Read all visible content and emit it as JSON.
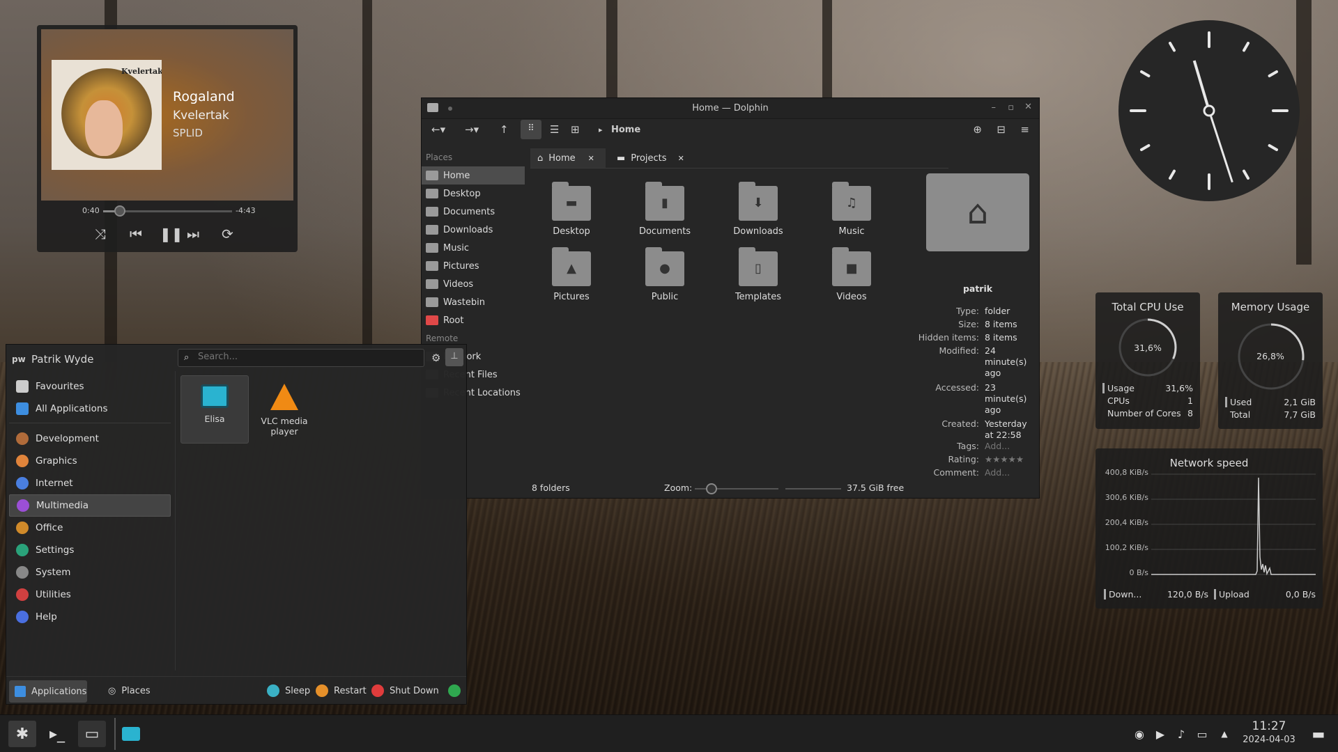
{
  "media": {
    "title": "Rogaland",
    "artist": "Kvelertak",
    "album": "SPLID",
    "band_logo": "Kvelertak",
    "elapsed": "0:40",
    "remaining": "-4:43",
    "progress": 0.13,
    "icons": [
      "shuffle-icon",
      "previous-icon",
      "pause-icon",
      "next-icon",
      "repeat-icon"
    ]
  },
  "dolphin": {
    "title": "Home — Dolphin",
    "breadcrumb": "Home",
    "places_header": "Places",
    "places": [
      "Home",
      "Desktop",
      "Documents",
      "Downloads",
      "Music",
      "Pictures",
      "Videos",
      "Wastebin",
      "Root"
    ],
    "remote_header": "Remote",
    "remote_items": [
      "Network"
    ],
    "recent_items": [
      "Recent Files",
      "Recent Locations"
    ],
    "tabs": [
      "Home",
      "Projects"
    ],
    "folders": [
      {
        "label": "Desktop",
        "glyph": "▬"
      },
      {
        "label": "Documents",
        "glyph": "▮"
      },
      {
        "label": "Downloads",
        "glyph": "⬇"
      },
      {
        "label": "Music",
        "glyph": "♫"
      },
      {
        "label": "Pictures",
        "glyph": "▲"
      },
      {
        "label": "Public",
        "glyph": "●"
      },
      {
        "label": "Templates",
        "glyph": "▯"
      },
      {
        "label": "Videos",
        "glyph": "■"
      }
    ],
    "info": {
      "name": "patrik",
      "rows": [
        [
          "Type:",
          "folder"
        ],
        [
          "Size:",
          "8 items"
        ],
        [
          "Hidden items:",
          "8 items"
        ],
        [
          "Modified:",
          "24 minute(s) ago"
        ],
        [
          "Accessed:",
          "23 minute(s) ago"
        ],
        [
          "Created:",
          "Yesterday at 22:58"
        ],
        [
          "Tags:",
          "Add..."
        ],
        [
          "Rating:",
          "★★★★★"
        ],
        [
          "Comment:",
          "Add..."
        ]
      ]
    },
    "status_left": "8 folders",
    "zoom_label": "Zoom:",
    "zoom_level": 0.1,
    "status_right": "37.5 GiB free"
  },
  "launcher": {
    "user": "Patrik Wyde",
    "search_placeholder": "Search...",
    "top": [
      {
        "label": "Favourites",
        "color": "#ccc"
      },
      {
        "label": "All Applications",
        "color": "#3d8ee0"
      }
    ],
    "categories": [
      {
        "label": "Development",
        "color": "#b06b3a"
      },
      {
        "label": "Graphics",
        "color": "#e0843b"
      },
      {
        "label": "Internet",
        "color": "#4a7fe0"
      },
      {
        "label": "Multimedia",
        "color": "#9b4fd6"
      },
      {
        "label": "Office",
        "color": "#d08a2a"
      },
      {
        "label": "Settings",
        "color": "#2aa27a"
      },
      {
        "label": "System",
        "color": "#888"
      },
      {
        "label": "Utilities",
        "color": "#d04040"
      },
      {
        "label": "Help",
        "color": "#4a6fe0"
      }
    ],
    "apps": [
      {
        "label": "Elisa"
      },
      {
        "label": "VLC media player"
      }
    ],
    "footer": {
      "applications": "Applications",
      "places": "Places",
      "sleep": "Sleep",
      "restart": "Restart",
      "shutdown": "Shut Down"
    }
  },
  "cpu": {
    "title": "Total CPU Use",
    "value": "31,6%",
    "percent": 31.6,
    "rows": [
      [
        "Usage",
        "31,6%"
      ],
      [
        "CPUs",
        "1"
      ],
      [
        "Number of Cores",
        "8"
      ]
    ]
  },
  "mem": {
    "title": "Memory Usage",
    "value": "26,8%",
    "percent": 26.8,
    "rows": [
      [
        "Used",
        "2,1 GiB"
      ],
      [
        "Total",
        "7,7 GiB"
      ]
    ]
  },
  "net": {
    "title": "Network speed",
    "yticks": [
      "400,8 KiB/s",
      "300,6 KiB/s",
      "200,4 KiB/s",
      "100,2 KiB/s",
      "0 B/s"
    ],
    "down_label": "Down...",
    "down_value": "120,0 B/s",
    "up_label": "Upload",
    "up_value": "0,0 B/s"
  },
  "clock_widget": {
    "hour": 11,
    "minute": 27
  },
  "taskbar": {
    "time": "11:27",
    "date": "2024-04-03",
    "icons": [
      "kde-menu-icon",
      "terminal-icon",
      "files-icon",
      "elisa-icon"
    ],
    "tray": [
      "updates-icon",
      "media-icon",
      "volume-icon",
      "display-icon",
      "tray-expand-icon",
      "desktop-icon"
    ]
  }
}
